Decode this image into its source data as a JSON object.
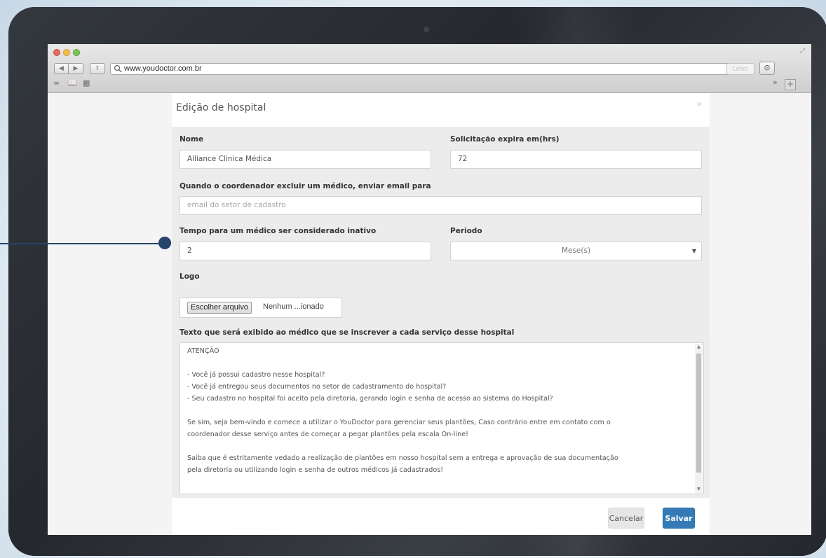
{
  "browser": {
    "url": "www.youdoctor.com.br",
    "reader_label": "Leitor"
  },
  "modal": {
    "title": "Edição de hospital",
    "close_label": "×",
    "fields": {
      "name_label": "Nome",
      "name_value": "Alliance Clinica Médica",
      "expiry_label": "Solicitação expira em(hrs)",
      "expiry_value": "72",
      "email_label": "Quando o coordenador excluir um médico, enviar email para",
      "email_placeholder": "email do setor de cadastro",
      "inactive_label": "Tempo para um médico ser considerado inativo",
      "inactive_value": "2",
      "period_label": "Periodo",
      "period_value": "Mese(s)",
      "logo_label": "Logo",
      "file_button": "Escolher arquivo",
      "file_status": "Nenhum ...ionado",
      "text_label": "Texto que será exibido ao médico que se inscrever a cada serviço desse hospital",
      "text_lines": [
        "ATENÇÃO",
        "",
        "- Você já possui cadastro nesse hospital?",
        "- Você já entregou seus documentos no setor de cadastramento do hospital?",
        "- Seu cadastro no hospital foi aceito pela diretoria, gerando login e senha de acesso ao sistema do Hospital?",
        "",
        "Se sim, seja bem-vindo e comece a utilizar o YouDoctor para gerenciar seus plantões, Caso contrário entre em contato com o",
        "coordenador desse serviço antes de começar a pegar plantões pela escala On-line!",
        "",
        "Saiba que é estritamente vedado a realização de plantões em nosso hospital sem a entrega e aprovação de sua documentação",
        "pela diretoria ou utilizando login e senha de outros médicos já cadastrados!"
      ]
    },
    "footer": {
      "cancel_label": "Cancelar",
      "save_label": "Salvar"
    }
  },
  "colors": {
    "primary": "#337ab7",
    "device_frame": "#2f3238",
    "pointer": "#25436b"
  }
}
